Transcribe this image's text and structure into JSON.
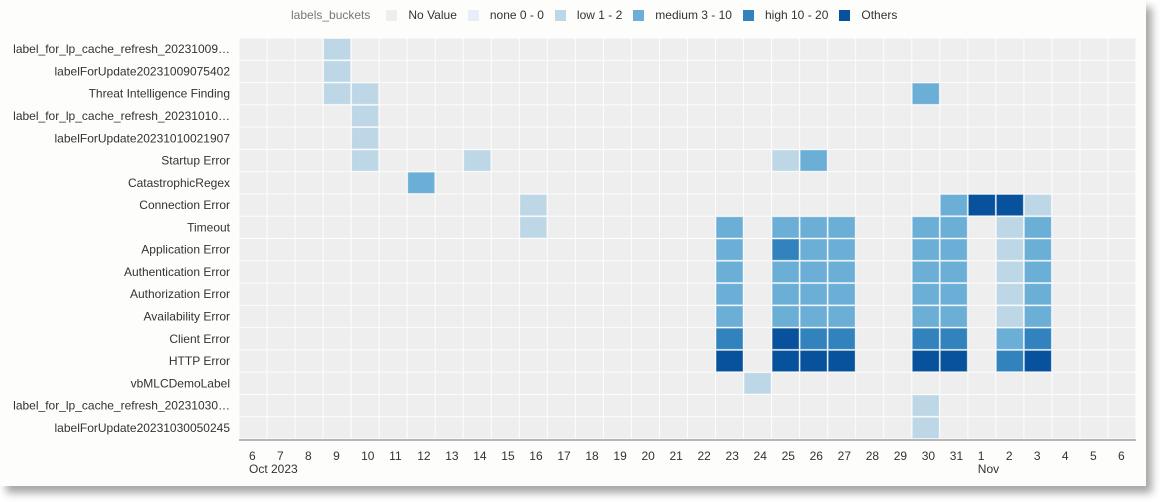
{
  "chart_data": {
    "type": "heatmap",
    "title": "",
    "xlabel": "",
    "ylabel": "",
    "legend": {
      "title": "labels_buckets",
      "placement": "top",
      "items": [
        {
          "key": "novalue",
          "label": "No Value",
          "color": "#eeeeee"
        },
        {
          "key": "none",
          "label": "none 0 - 0",
          "color": "#e6eff8"
        },
        {
          "key": "low",
          "label": "low 1 - 2",
          "color": "#bdd7e7"
        },
        {
          "key": "medium",
          "label": "medium 3 - 10",
          "color": "#6baed6"
        },
        {
          "key": "high",
          "label": "high 10 - 20",
          "color": "#3182bd"
        },
        {
          "key": "others",
          "label": "Others",
          "color": "#08519c"
        }
      ]
    },
    "x": [
      "6",
      "7",
      "8",
      "9",
      "10",
      "11",
      "12",
      "13",
      "14",
      "15",
      "16",
      "17",
      "18",
      "19",
      "20",
      "21",
      "22",
      "23",
      "24",
      "25",
      "26",
      "27",
      "28",
      "29",
      "30",
      "31",
      "1",
      "2",
      "3",
      "4",
      "5",
      "6"
    ],
    "x_sublabels": [
      {
        "index": 0,
        "label": "Oct 2023"
      },
      {
        "index": 26,
        "label": "Nov"
      }
    ],
    "y": [
      "label_for_lp_cache_refresh_20231009…",
      "labelForUpdate20231009075402",
      "Threat Intelligence Finding",
      "label_for_lp_cache_refresh_20231010…",
      "labelForUpdate20231010021907",
      "Startup Error",
      "CatastrophicRegex",
      "Connection Error",
      "Timeout",
      "Application Error",
      "Authentication Error",
      "Authorization Error",
      "Availability Error",
      "Client Error",
      "HTTP Error",
      "vbMLCDemoLabel",
      "label_for_lp_cache_refresh_20231030…",
      "labelForUpdate20231030050245"
    ],
    "cells": [
      {
        "row": 0,
        "col": 3,
        "bucket": "low"
      },
      {
        "row": 1,
        "col": 3,
        "bucket": "low"
      },
      {
        "row": 2,
        "col": 3,
        "bucket": "low"
      },
      {
        "row": 2,
        "col": 4,
        "bucket": "low"
      },
      {
        "row": 2,
        "col": 24,
        "bucket": "medium"
      },
      {
        "row": 3,
        "col": 4,
        "bucket": "low"
      },
      {
        "row": 4,
        "col": 4,
        "bucket": "low"
      },
      {
        "row": 5,
        "col": 4,
        "bucket": "low"
      },
      {
        "row": 5,
        "col": 8,
        "bucket": "low"
      },
      {
        "row": 5,
        "col": 19,
        "bucket": "low"
      },
      {
        "row": 5,
        "col": 20,
        "bucket": "medium"
      },
      {
        "row": 6,
        "col": 6,
        "bucket": "medium"
      },
      {
        "row": 7,
        "col": 10,
        "bucket": "low"
      },
      {
        "row": 7,
        "col": 25,
        "bucket": "medium"
      },
      {
        "row": 7,
        "col": 26,
        "bucket": "others"
      },
      {
        "row": 7,
        "col": 27,
        "bucket": "others"
      },
      {
        "row": 7,
        "col": 28,
        "bucket": "low"
      },
      {
        "row": 8,
        "col": 10,
        "bucket": "low"
      },
      {
        "row": 8,
        "col": 17,
        "bucket": "medium"
      },
      {
        "row": 8,
        "col": 19,
        "bucket": "medium"
      },
      {
        "row": 8,
        "col": 20,
        "bucket": "medium"
      },
      {
        "row": 8,
        "col": 21,
        "bucket": "medium"
      },
      {
        "row": 8,
        "col": 24,
        "bucket": "medium"
      },
      {
        "row": 8,
        "col": 25,
        "bucket": "medium"
      },
      {
        "row": 8,
        "col": 27,
        "bucket": "low"
      },
      {
        "row": 8,
        "col": 28,
        "bucket": "medium"
      },
      {
        "row": 9,
        "col": 17,
        "bucket": "medium"
      },
      {
        "row": 9,
        "col": 19,
        "bucket": "high"
      },
      {
        "row": 9,
        "col": 20,
        "bucket": "medium"
      },
      {
        "row": 9,
        "col": 21,
        "bucket": "medium"
      },
      {
        "row": 9,
        "col": 24,
        "bucket": "medium"
      },
      {
        "row": 9,
        "col": 25,
        "bucket": "medium"
      },
      {
        "row": 9,
        "col": 27,
        "bucket": "low"
      },
      {
        "row": 9,
        "col": 28,
        "bucket": "medium"
      },
      {
        "row": 10,
        "col": 17,
        "bucket": "medium"
      },
      {
        "row": 10,
        "col": 19,
        "bucket": "medium"
      },
      {
        "row": 10,
        "col": 20,
        "bucket": "medium"
      },
      {
        "row": 10,
        "col": 21,
        "bucket": "medium"
      },
      {
        "row": 10,
        "col": 24,
        "bucket": "medium"
      },
      {
        "row": 10,
        "col": 25,
        "bucket": "medium"
      },
      {
        "row": 10,
        "col": 27,
        "bucket": "low"
      },
      {
        "row": 10,
        "col": 28,
        "bucket": "medium"
      },
      {
        "row": 11,
        "col": 17,
        "bucket": "medium"
      },
      {
        "row": 11,
        "col": 19,
        "bucket": "medium"
      },
      {
        "row": 11,
        "col": 20,
        "bucket": "medium"
      },
      {
        "row": 11,
        "col": 21,
        "bucket": "medium"
      },
      {
        "row": 11,
        "col": 24,
        "bucket": "medium"
      },
      {
        "row": 11,
        "col": 25,
        "bucket": "medium"
      },
      {
        "row": 11,
        "col": 27,
        "bucket": "low"
      },
      {
        "row": 11,
        "col": 28,
        "bucket": "medium"
      },
      {
        "row": 12,
        "col": 17,
        "bucket": "medium"
      },
      {
        "row": 12,
        "col": 19,
        "bucket": "medium"
      },
      {
        "row": 12,
        "col": 20,
        "bucket": "medium"
      },
      {
        "row": 12,
        "col": 21,
        "bucket": "medium"
      },
      {
        "row": 12,
        "col": 24,
        "bucket": "medium"
      },
      {
        "row": 12,
        "col": 25,
        "bucket": "medium"
      },
      {
        "row": 12,
        "col": 27,
        "bucket": "low"
      },
      {
        "row": 12,
        "col": 28,
        "bucket": "medium"
      },
      {
        "row": 13,
        "col": 17,
        "bucket": "high"
      },
      {
        "row": 13,
        "col": 19,
        "bucket": "others"
      },
      {
        "row": 13,
        "col": 20,
        "bucket": "high"
      },
      {
        "row": 13,
        "col": 21,
        "bucket": "high"
      },
      {
        "row": 13,
        "col": 24,
        "bucket": "high"
      },
      {
        "row": 13,
        "col": 25,
        "bucket": "high"
      },
      {
        "row": 13,
        "col": 27,
        "bucket": "medium"
      },
      {
        "row": 13,
        "col": 28,
        "bucket": "high"
      },
      {
        "row": 14,
        "col": 17,
        "bucket": "others"
      },
      {
        "row": 14,
        "col": 19,
        "bucket": "others"
      },
      {
        "row": 14,
        "col": 20,
        "bucket": "others"
      },
      {
        "row": 14,
        "col": 21,
        "bucket": "others"
      },
      {
        "row": 14,
        "col": 24,
        "bucket": "others"
      },
      {
        "row": 14,
        "col": 25,
        "bucket": "others"
      },
      {
        "row": 14,
        "col": 27,
        "bucket": "high"
      },
      {
        "row": 14,
        "col": 28,
        "bucket": "others"
      },
      {
        "row": 15,
        "col": 18,
        "bucket": "low"
      },
      {
        "row": 16,
        "col": 24,
        "bucket": "low"
      },
      {
        "row": 17,
        "col": 24,
        "bucket": "low"
      }
    ],
    "default_bucket": "novalue",
    "grid": true
  }
}
